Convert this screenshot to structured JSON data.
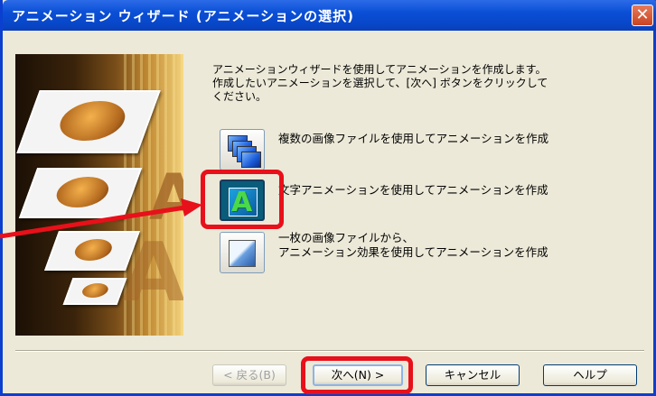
{
  "window": {
    "title": "アニメーション ウィザード (アニメーションの選択)",
    "close_glyph": "✕"
  },
  "intro": {
    "line1": "アニメーションウィザードを使用してアニメーションを作成します。",
    "line2": "作成したいアニメーションを選択して、[次へ] ボタンをクリックして",
    "line3": "ください。"
  },
  "options": [
    {
      "icon": "image-stack-icon",
      "label_lines": [
        "複数の画像ファイルを使用してアニメーションを作成"
      ],
      "selected": false
    },
    {
      "icon": "text-animation-icon",
      "icon_text": "A",
      "label_lines": [
        "文字アニメーションを使用してアニメーションを作成"
      ],
      "selected": true
    },
    {
      "icon": "single-image-icon",
      "label_lines": [
        "一枚の画像ファイルから、",
        "アニメーション効果を使用してアニメーションを作成"
      ],
      "selected": false
    }
  ],
  "buttons": {
    "back": "< 戻る(B)",
    "next": "次へ(N) >",
    "cancel": "キャンセル",
    "help": "ヘルプ"
  },
  "hero": {
    "letter": "A"
  },
  "colors": {
    "highlight": "#e8101a",
    "titlebar": "#0a4fd6",
    "dialog_bg": "#ece9d8"
  }
}
